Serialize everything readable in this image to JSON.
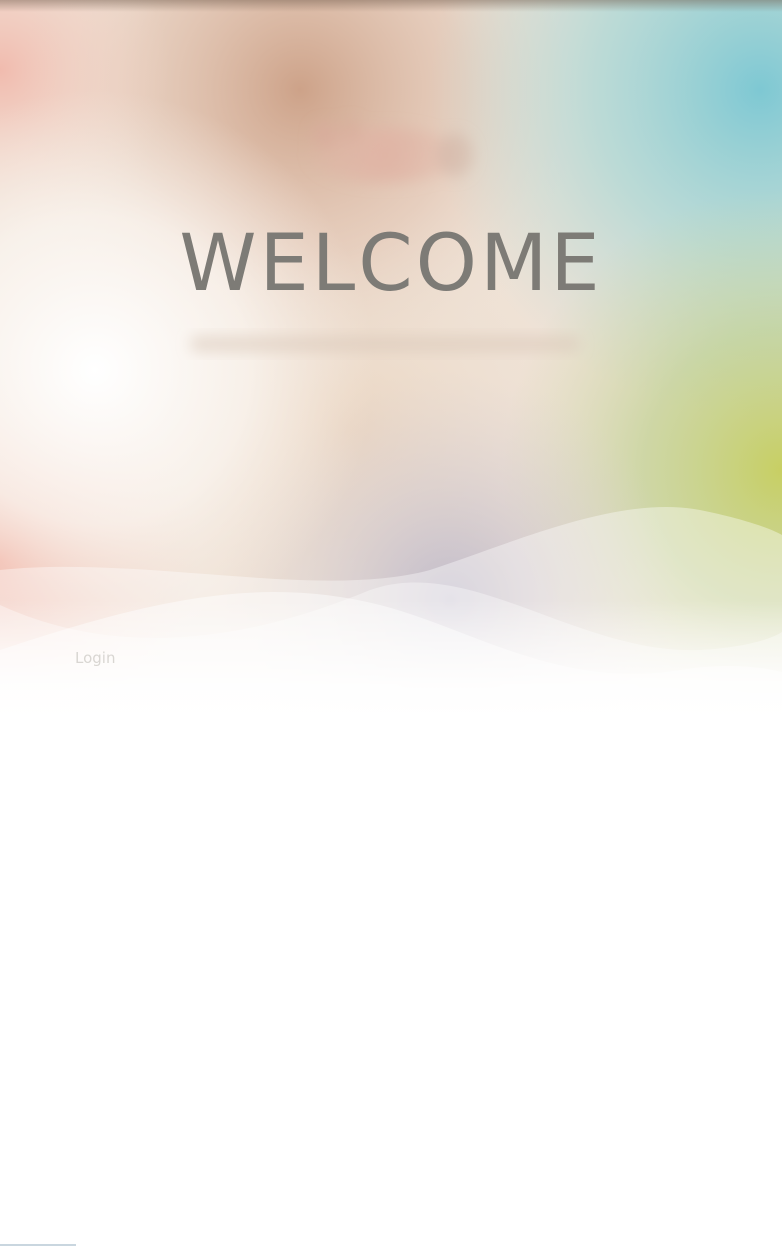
{
  "hero": {
    "title": "WELCOME"
  },
  "nav": {
    "login_label": "Login"
  },
  "colors": {
    "title_text": "#7d7b76",
    "login_text": "#d9d6d2",
    "warm_peach": "#f2c7b8",
    "teal": "#7ec8d3",
    "lime": "#c8cf63",
    "coral": "#f0a99a",
    "lavender": "#c4c4d6"
  },
  "decorations": {
    "logo": "blurred-logo",
    "subtitle": "blurred-subtitle-text"
  }
}
